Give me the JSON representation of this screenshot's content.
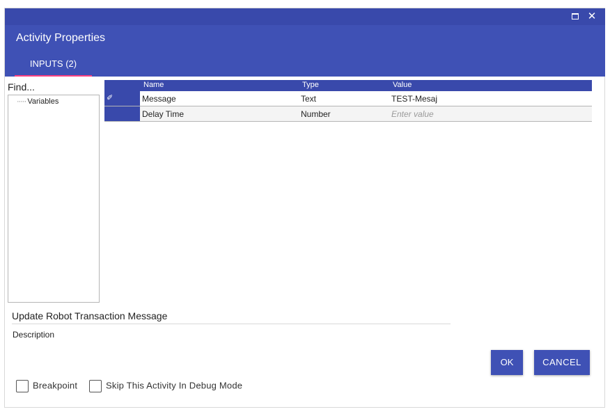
{
  "window": {
    "maximize_icon": "maximize-icon",
    "close_glyph": "✕"
  },
  "header": {
    "title": "Activity Properties",
    "tab_label": "INPUTS (2)",
    "accent_color": "#ff4081",
    "brand_color": "#3f51b5"
  },
  "sidebar": {
    "find_label": "Find...",
    "tree_items": [
      "Variables"
    ]
  },
  "grid": {
    "columns": [
      "Name",
      "Type",
      "Value"
    ],
    "rows": [
      {
        "name": "Message",
        "type": "Text",
        "value": "TEST-Mesaj",
        "edit_icon": "✐"
      },
      {
        "name": "Delay Time",
        "type": "Number",
        "value": "",
        "placeholder": "Enter value"
      }
    ]
  },
  "activity": {
    "title": "Update Robot Transaction Message",
    "description_label": "Description"
  },
  "buttons": {
    "ok": "OK",
    "cancel": "CANCEL"
  },
  "options": {
    "breakpoint_label": "Breakpoint",
    "skip_label": "Skip This Activity In Debug Mode"
  }
}
